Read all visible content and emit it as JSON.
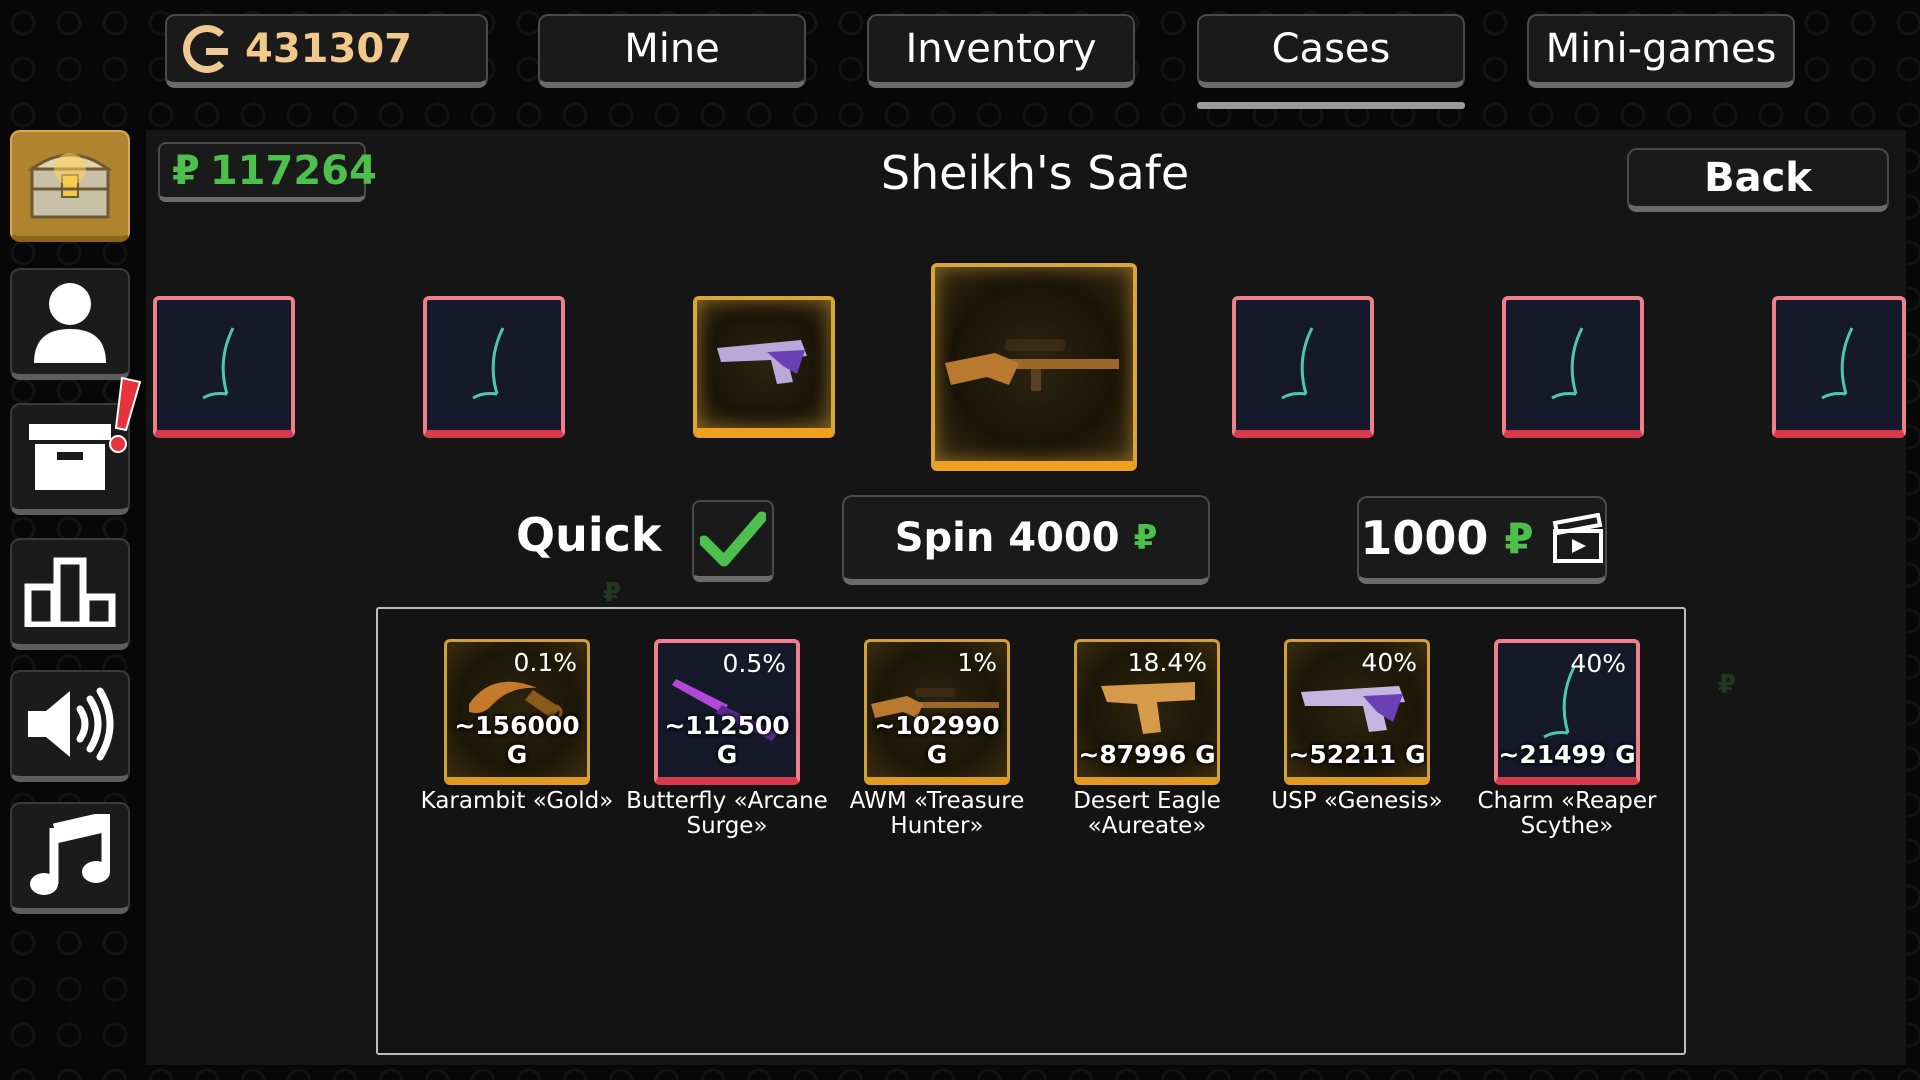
{
  "header": {
    "g_balance": "431307",
    "tabs": [
      {
        "label": "Mine"
      },
      {
        "label": "Inventory"
      },
      {
        "label": "Cases"
      },
      {
        "label": "Mini-games"
      }
    ],
    "active_tab": "Cases"
  },
  "sidebar": {
    "items": [
      {
        "icon": "treasure-chest-icon",
        "active": true
      },
      {
        "icon": "profile-icon"
      },
      {
        "icon": "crate-icon",
        "badge": "!"
      },
      {
        "icon": "leaderboard-icon"
      },
      {
        "icon": "sound-icon"
      },
      {
        "icon": "music-icon"
      }
    ]
  },
  "case": {
    "p_balance": "117264",
    "title": "Sheikh's Safe",
    "back_label": "Back"
  },
  "controls": {
    "quick_label": "Quick",
    "quick_checked": true,
    "spin_label": "Spin 4000",
    "ad_amount": "1000"
  },
  "currency": {
    "p_symbol": "₽",
    "g_symbol": "G"
  },
  "drops": [
    {
      "chance": "0.1%",
      "price": "~156000",
      "name": "Karambit «Gold»",
      "rarity": "gold",
      "icon": "karambit-knife-icon"
    },
    {
      "chance": "0.5%",
      "price": "~112500",
      "name": "Butterfly «Arcane Surge»",
      "rarity": "red",
      "icon": "butterfly-knife-icon"
    },
    {
      "chance": "1%",
      "price": "~102990",
      "name": "AWM «Treasure Hunter»",
      "rarity": "gold",
      "icon": "sniper-rifle-icon"
    },
    {
      "chance": "18.4%",
      "price": "~87996",
      "name": "Desert Eagle «Aureate»",
      "rarity": "gold",
      "icon": "pistol-icon"
    },
    {
      "chance": "40%",
      "price": "~52211",
      "name": "USP «Genesis»",
      "rarity": "gold",
      "icon": "pistol-icon"
    },
    {
      "chance": "40%",
      "price": "~21499",
      "name": "Charm «Reaper Scythe»",
      "rarity": "red",
      "icon": "scythe-charm-icon"
    }
  ],
  "colors": {
    "gold": "#d9a63a",
    "red": "#ef7f8c",
    "green": "#4dbf4d",
    "g_currency": "#f2c98c"
  }
}
